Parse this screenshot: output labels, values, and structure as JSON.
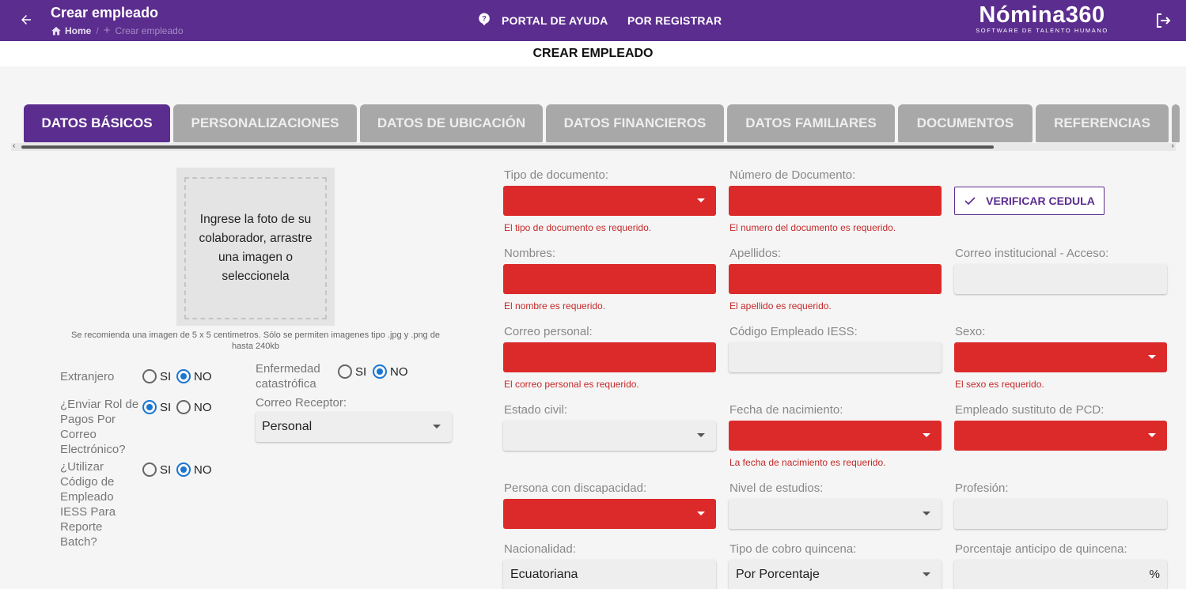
{
  "header": {
    "title": "Crear empleado",
    "breadcrumb_home": "Home",
    "breadcrumb_current": "Crear empleado",
    "nav_help": "PORTAL DE AYUDA",
    "nav_register": "POR REGISTRAR",
    "logo_brand": "Nómina360",
    "logo_tagline": "SOFTWARE DE TALENTO HUMANO",
    "colors": {
      "primary": "#5b2d8e",
      "error": "#dc2a2a"
    }
  },
  "subheader": "CREAR EMPLEADO",
  "tabs": [
    {
      "label": "DATOS BÁSICOS",
      "active": true
    },
    {
      "label": "PERSONALIZACIONES",
      "active": false
    },
    {
      "label": "DATOS DE UBICACIÓN",
      "active": false
    },
    {
      "label": "DATOS FINANCIEROS",
      "active": false
    },
    {
      "label": "DATOS FAMILIARES",
      "active": false
    },
    {
      "label": "DOCUMENTOS",
      "active": false
    },
    {
      "label": "REFERENCIAS",
      "active": false
    }
  ],
  "photo": {
    "prompt": "Ingrese la foto de su colaborador, arrastre una imagen o seleccionela",
    "hint": "Se recomienda una imagen de 5 x 5 centimetros. Sólo se permiten imagenes tipo .jpg y .png de hasta 240kb"
  },
  "options": {
    "yes": "SI",
    "no": "NO",
    "extranjero": {
      "label": "Extranjero",
      "selected": "NO"
    },
    "enfermedad": {
      "label": "Enfermedad catastrófica",
      "selected": "NO"
    },
    "enviar_rol": {
      "label": "¿Enviar Rol de Pagos Por Correo Electrónico?",
      "selected": "SI"
    },
    "correo_receptor": {
      "label": "Correo Receptor:",
      "value": "Personal"
    },
    "codigo_iess": {
      "label": "¿Utilizar Código de Empleado IESS Para Reporte Batch?",
      "selected": "NO"
    }
  },
  "form": {
    "tipo_documento": {
      "label": "Tipo de documento:",
      "error": "El tipo de documento es requerido."
    },
    "numero_documento": {
      "label": "Número de Documento:",
      "error": "El numero del documento es requerido."
    },
    "verificar": "VERIFICAR CEDULA",
    "nombres": {
      "label": "Nombres:",
      "error": "El nombre es requerido."
    },
    "apellidos": {
      "label": "Apellidos:",
      "error": "El apellido es requerido."
    },
    "correo_institucional": {
      "label": "Correo institucional - Acceso:"
    },
    "correo_personal": {
      "label": "Correo personal:",
      "error": "El correo personal es requerido."
    },
    "codigo_empleado_iess": {
      "label": "Código Empleado IESS:"
    },
    "sexo": {
      "label": "Sexo:",
      "error": "El sexo es requerido."
    },
    "estado_civil": {
      "label": "Estado civil:"
    },
    "fecha_nacimiento": {
      "label": "Fecha de nacimiento:",
      "error": "La fecha de nacimiento es requerido."
    },
    "sustituto_pcd": {
      "label": "Empleado sustituto de PCD:"
    },
    "discapacidad": {
      "label": "Persona con discapacidad:"
    },
    "nivel_estudios": {
      "label": "Nivel de estudios:"
    },
    "profesion": {
      "label": "Profesión:"
    },
    "nacionalidad": {
      "label": "Nacionalidad:",
      "value": "Ecuatoriana"
    },
    "tipo_cobro": {
      "label": "Tipo de cobro quincena:",
      "value": "Por Porcentaje"
    },
    "porcentaje_anticipo": {
      "label": "Porcentaje anticipo de quincena:",
      "suffix": "%"
    }
  }
}
